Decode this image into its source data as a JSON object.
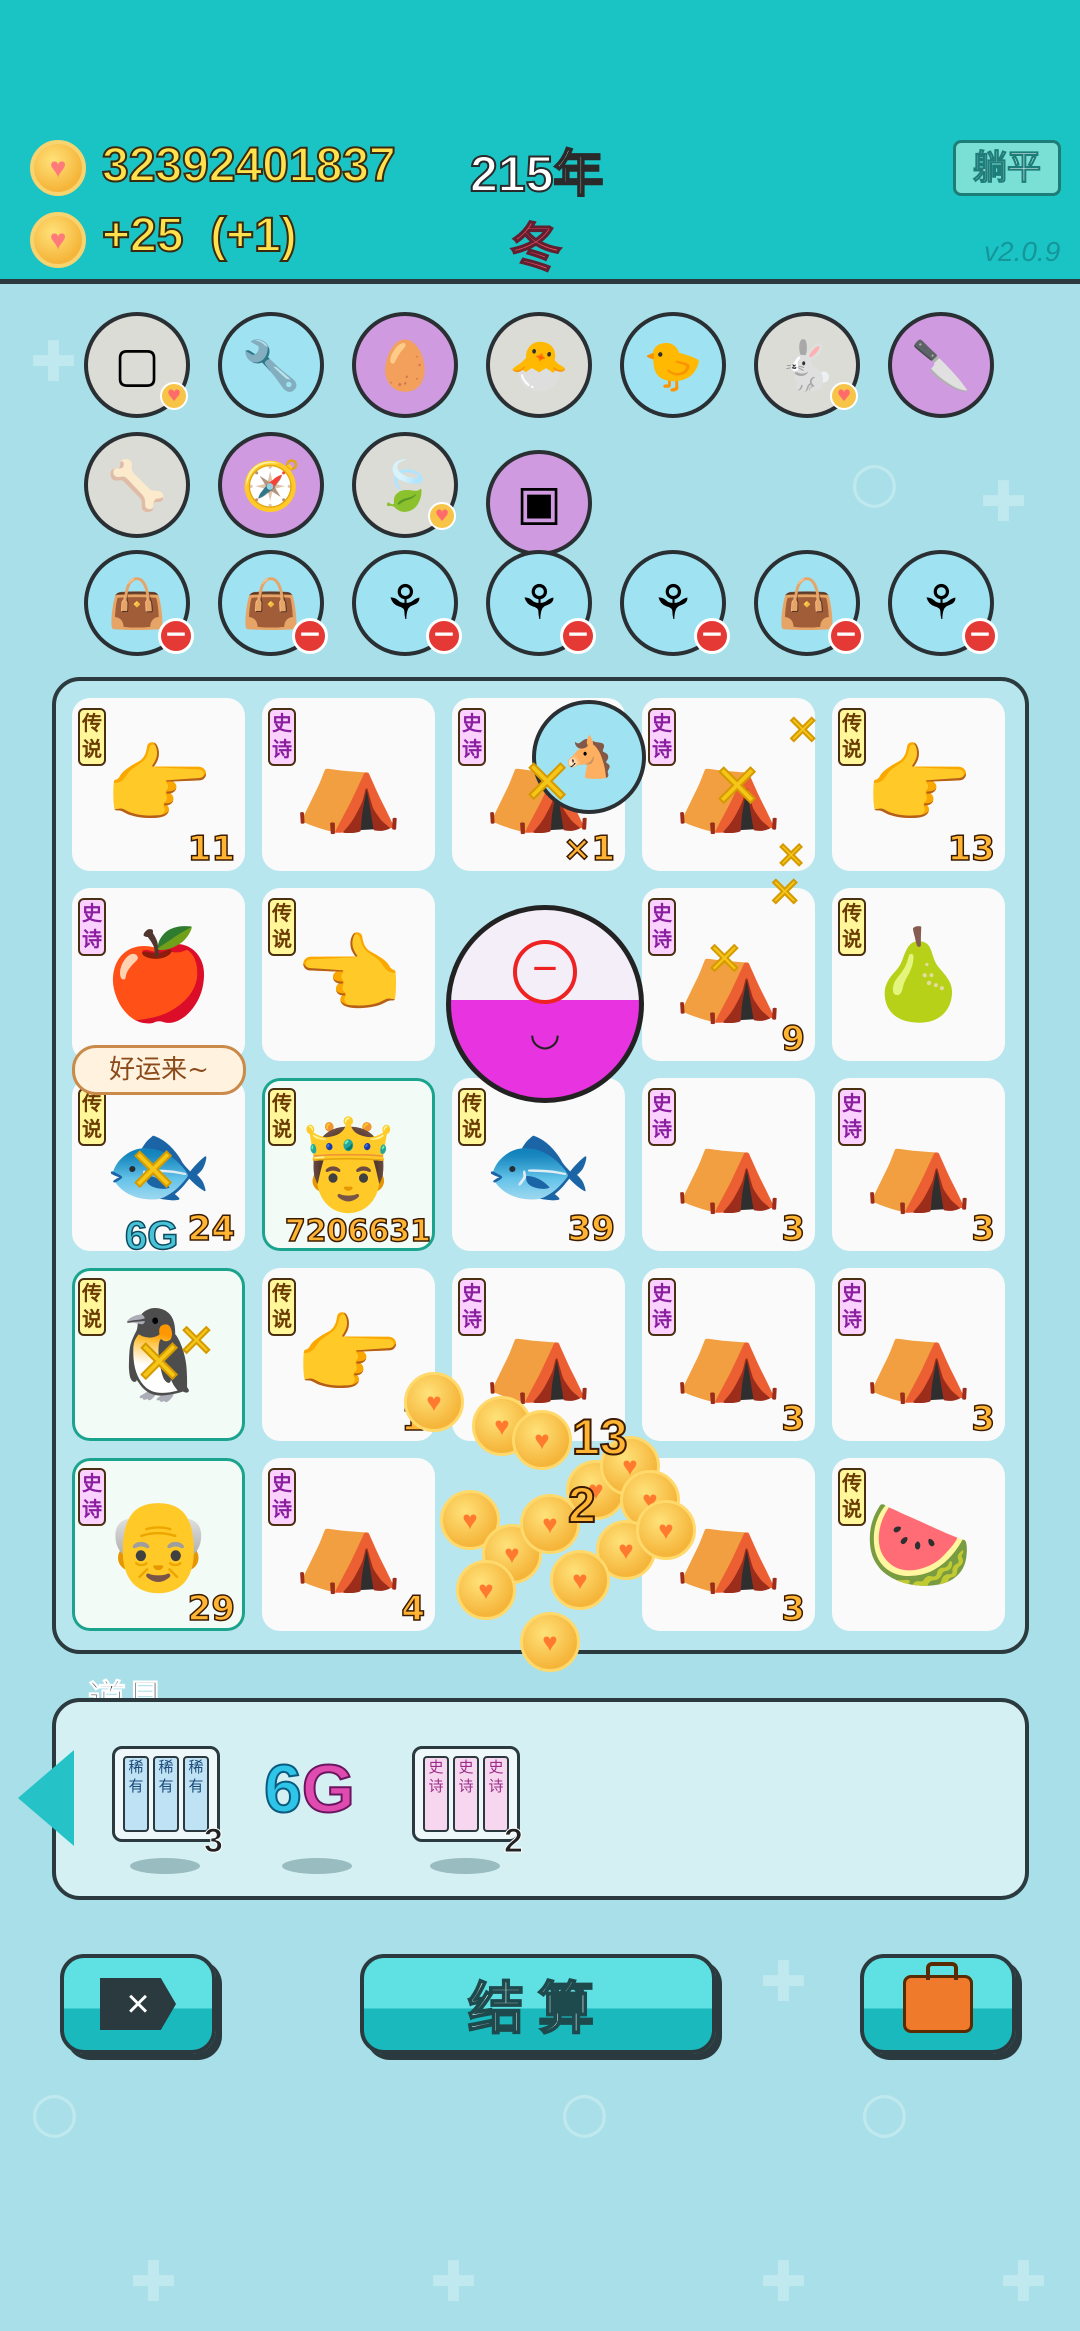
{
  "header": {
    "coins": "32392401837",
    "coin_rate": "+25  (+1)",
    "year": "215年",
    "season": "冬",
    "lie_flat_button": "躺平",
    "version": "v2.0.9"
  },
  "inventory_items": [
    {
      "icon": "sugar-cubes",
      "glyph": "▢"
    },
    {
      "icon": "wrench-shield",
      "glyph": "🔧"
    },
    {
      "icon": "egg",
      "glyph": "🥚"
    },
    {
      "icon": "chick-with-egg",
      "glyph": "🐣"
    },
    {
      "icon": "chick-with-egg",
      "glyph": "🐤"
    },
    {
      "icon": "rabbit",
      "glyph": "🐇"
    },
    {
      "icon": "cleaver",
      "glyph": "🔪"
    },
    {
      "icon": "dog-bowl",
      "glyph": "🦴"
    },
    {
      "icon": "compass",
      "glyph": "🧭"
    },
    {
      "icon": "leaf",
      "glyph": "🍃"
    },
    {
      "icon": "capsule-pack",
      "glyph": "▣"
    },
    {
      "icon": "seed-bag",
      "glyph": "👜"
    },
    {
      "icon": "seed-bag",
      "glyph": "👜"
    },
    {
      "icon": "potted-flower",
      "glyph": "⚘"
    },
    {
      "icon": "potted-flower",
      "glyph": "⚘"
    },
    {
      "icon": "potted-flower",
      "glyph": "⚘"
    },
    {
      "icon": "seed-bag",
      "glyph": "👜"
    },
    {
      "icon": "potted-flower",
      "glyph": "⚘"
    }
  ],
  "board": {
    "cells": [
      {
        "tag": "传说",
        "icon": "pointing-hand",
        "glyph": "👉",
        "count": "11"
      },
      {
        "tag": "史诗",
        "icon": "rabbit-tent",
        "glyph": "⛺",
        "count": ""
      },
      {
        "tag": "史诗",
        "icon": "rabbit-tent",
        "glyph": "⛺",
        "count": "×1"
      },
      {
        "tag": "史诗",
        "icon": "rabbit-tent",
        "glyph": "⛺",
        "count": ""
      },
      {
        "tag": "传说",
        "icon": "pointing-hand",
        "glyph": "👉",
        "count": "13"
      },
      {
        "tag": "史诗",
        "icon": "apple",
        "glyph": "🍎",
        "count": ""
      },
      {
        "tag": "传说",
        "icon": "pointing-hand",
        "glyph": "👈",
        "count": ""
      },
      {
        "tag": "",
        "icon": "gacha-capsule",
        "glyph": "",
        "count": ""
      },
      {
        "tag": "史诗",
        "icon": "rabbit-tent",
        "glyph": "⛺",
        "count": "9"
      },
      {
        "tag": "传说",
        "icon": "twin-fruit",
        "glyph": "🍐",
        "count": ""
      },
      {
        "tag": "传说",
        "icon": "koi-fish",
        "glyph": "🐟",
        "count": "24"
      },
      {
        "tag": "传说",
        "icon": "king-face",
        "glyph": "🤴",
        "count": "7206631"
      },
      {
        "tag": "传说",
        "icon": "koi-fish",
        "glyph": "🐟",
        "count": "39"
      },
      {
        "tag": "史诗",
        "icon": "rabbit-tent",
        "glyph": "⛺",
        "count": "3"
      },
      {
        "tag": "史诗",
        "icon": "rabbit-tent",
        "glyph": "⛺",
        "count": "3"
      },
      {
        "tag": "传说",
        "icon": "king-penguin",
        "glyph": "🐧",
        "count": ""
      },
      {
        "tag": "传说",
        "icon": "pointing-hand",
        "glyph": "👉",
        "count": "1"
      },
      {
        "tag": "史诗",
        "icon": "rabbit-tent",
        "glyph": "⛺",
        "count": ""
      },
      {
        "tag": "史诗",
        "icon": "rabbit-tent",
        "glyph": "⛺",
        "count": "3"
      },
      {
        "tag": "史诗",
        "icon": "rabbit-tent",
        "glyph": "⛺",
        "count": "3"
      },
      {
        "tag": "史诗",
        "icon": "old-king",
        "glyph": "👴",
        "count": "29"
      },
      {
        "tag": "史诗",
        "icon": "rabbit-tent",
        "glyph": "⛺",
        "count": "4"
      },
      {
        "tag": "",
        "icon": "gacha-capsule",
        "glyph": "",
        "count": ""
      },
      {
        "tag": "",
        "icon": "rabbit-tent",
        "glyph": "⛺",
        "count": "3"
      },
      {
        "tag": "传说",
        "icon": "watermelon",
        "glyph": "🍉",
        "count": ""
      }
    ],
    "speech_bubble": "好运来~",
    "six_g_overlay": "6G",
    "float_numbers": [
      "13",
      "2"
    ]
  },
  "tools": {
    "label": "道具",
    "items": [
      {
        "type": "rare-pack",
        "slot_text": "稀有",
        "count": "3"
      },
      {
        "type": "6g",
        "text_6": "6",
        "text_g": "G",
        "count": ""
      },
      {
        "type": "epic-pack",
        "slot_text": "史诗",
        "count": "2"
      }
    ]
  },
  "buttons": {
    "close": "×",
    "settle": "结算",
    "bag": ""
  }
}
